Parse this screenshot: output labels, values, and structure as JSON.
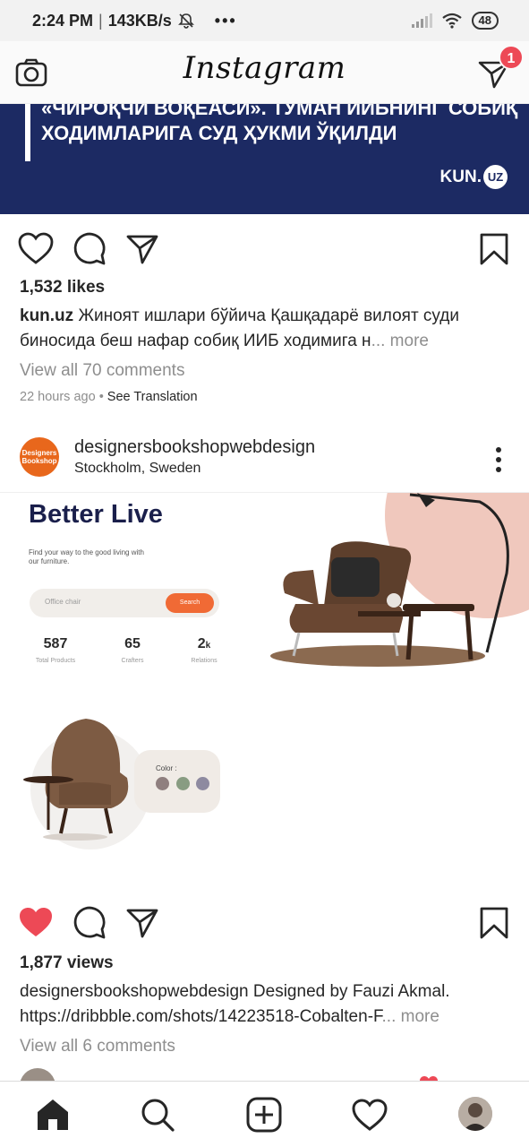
{
  "status_bar": {
    "time": "2:24 PM",
    "net": "143KB/s",
    "more_dots": "•••",
    "battery": "48",
    "icons": [
      "mute-bell-icon",
      "signal-icon",
      "wifi-icon",
      "battery-icon"
    ]
  },
  "header": {
    "title": "Instagram",
    "direct_badge": "1",
    "icons": [
      "camera-icon",
      "direct-message-icon"
    ]
  },
  "post1": {
    "banner": {
      "line1": "«ЧИРОҚЧИ ВОҚЕАСИ». ТУМАН ИИБНИНГ СОБИҚ",
      "line2": "ХОДИМЛАРИГА СУД ҲУКМИ ЎҚИЛДИ",
      "brand": "KUN.",
      "brand_badge": "UZ"
    },
    "likes": "1,532 likes",
    "caption_user": "kun.uz",
    "caption_line1": "Жиноят ишлари бўйича Қашқадарё вилоят суди",
    "caption_line2": "биносида беш нафар собиқ ИИБ ходимига н",
    "more": "... more",
    "view_comments": "View all 70 comments",
    "time": "22 hours ago",
    "dot": "•",
    "see_translation": "See Translation"
  },
  "post2": {
    "avatar_text_1": "Designers",
    "avatar_text_2": "Bookshop",
    "username": "designersbookshopwebdesign",
    "location": "Stockholm, Sweden",
    "image": {
      "headline": "Better Live",
      "subtitle": "Find your way to the good living with our furniture.",
      "search_placeholder": "Office chair",
      "search_button": "Search",
      "stats": [
        {
          "num": "587",
          "label": "Total Products"
        },
        {
          "num": "65",
          "label": "Crafters"
        },
        {
          "num": "2",
          "suffix": "k",
          "label": "Relations"
        }
      ],
      "color_label": "Color :",
      "swatches": [
        "#8f7f7f",
        "#889c82",
        "#8e8aa0"
      ]
    },
    "views": "1,877 views",
    "caption_user": "designersbookshopwebdesign",
    "caption_rest": " Designed by Fauzi Akmal.",
    "caption_line2": "https://dribbble.com/shots/14223518-Cobalten-F",
    "more": "... more",
    "view_comments": "View all 6 comments",
    "liked": true
  },
  "bottom_nav": [
    "home-icon",
    "search-icon",
    "add-post-icon",
    "activity-heart-icon",
    "profile-avatar"
  ],
  "colors": {
    "like_red": "#ed4956",
    "banner_blue": "#1c2a63",
    "accent_orange": "#f06a35"
  }
}
